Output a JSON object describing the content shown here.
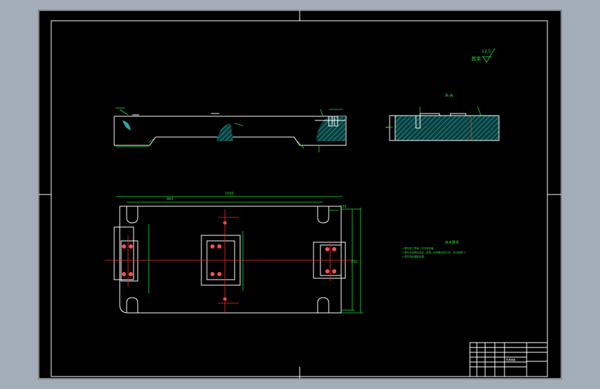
{
  "drawing": {
    "section_label": "A-A",
    "roughness_label": "其余",
    "roughness_value": "12.5",
    "tech_req_title": "技术要求",
    "tech_req_lines": [
      "1.零件加工表面上不应有划痕。",
      "2.零件去除氧化皮后，锐角、毛刺等去除干净，未注倒角C1。",
      "3.零件须经调质处理。"
    ],
    "dim_overall_length": "1000",
    "dim_inner_length": "860",
    "dim_height": "400",
    "dim_side": "330",
    "title_block_name": "夹具底板"
  },
  "colors": {
    "frame": "#ffffff",
    "dimension": "#22e03a",
    "center": "#ff2828",
    "hatch": "#2aa6a6"
  }
}
